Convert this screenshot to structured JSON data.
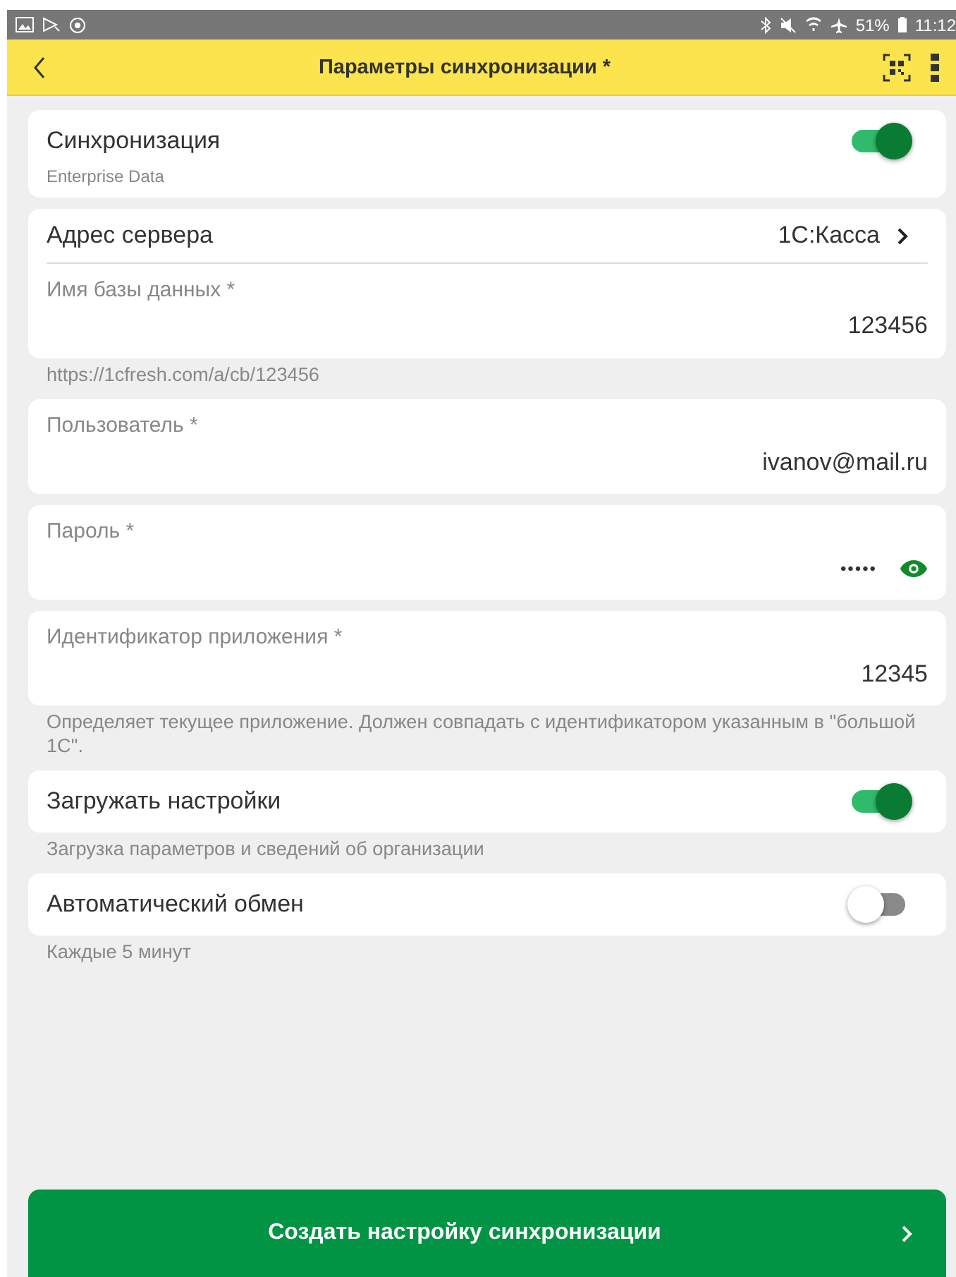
{
  "status_bar": {
    "battery": "51%",
    "time": "11:12"
  },
  "header": {
    "title": "Параметры синхронизации *"
  },
  "blocks": [
    {
      "kind": "toggle",
      "label": "Синхронизация",
      "sublabel": "Enterprise Data",
      "on": true
    },
    {
      "kind": "server",
      "label": "Адрес сервера",
      "value": "1С:Касса",
      "field": {
        "label": "Имя базы данных *",
        "value": "123456"
      }
    },
    {
      "kind": "hint",
      "text": "https://1cfresh.com/a/cb/123456"
    },
    {
      "kind": "field",
      "label": "Пользователь *",
      "value": "ivanov@mail.ru"
    },
    {
      "kind": "password",
      "label": "Пароль *",
      "value": "•••••"
    },
    {
      "kind": "field",
      "label": "Идентификатор приложения *",
      "value": "12345"
    },
    {
      "kind": "hint",
      "text": "Определяет текущее приложение. Должен совпадать с идентификатором указанным в \"большой 1С\"."
    },
    {
      "kind": "toggle",
      "label": "Загружать настройки",
      "on": true
    },
    {
      "kind": "hint",
      "text": "Загрузка параметров и сведений об организации"
    },
    {
      "kind": "toggle",
      "label": "Автоматический обмен",
      "on": false
    },
    {
      "kind": "hint",
      "text": "Каждые 5 минут"
    }
  ],
  "action_button": {
    "label": "Создать настройку синхронизации"
  }
}
